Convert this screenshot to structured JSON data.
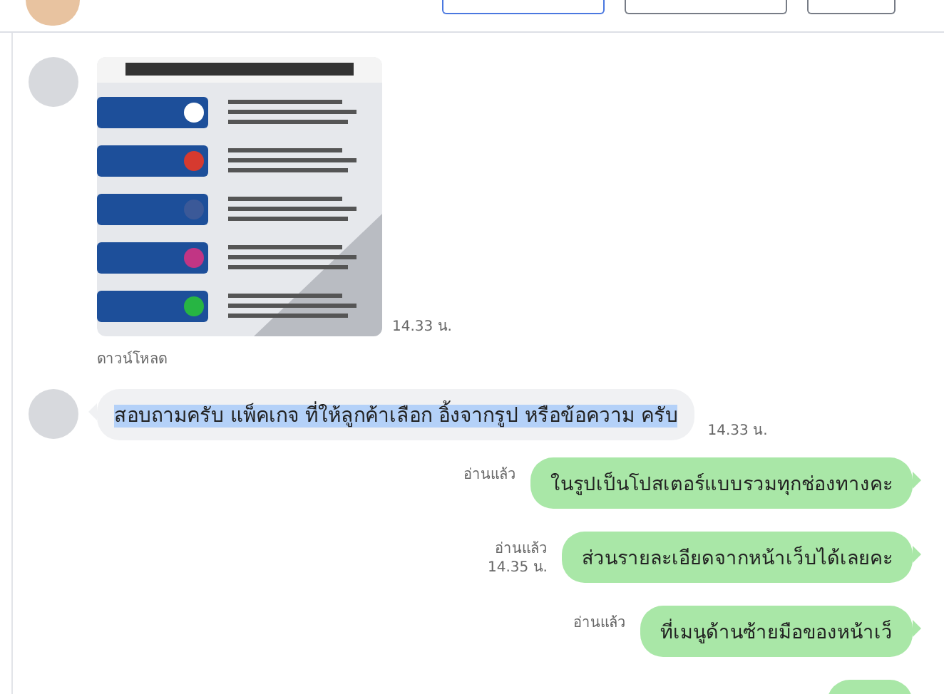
{
  "messages": [
    {
      "kind": "image",
      "time": "14.33 น.",
      "download": "ดาวน์โหลด"
    },
    {
      "kind": "incoming",
      "text": "สอบถามครับ แพ็คเกจ ที่ให้ลูกค้าเลือก อิ้งจากรูป หรือข้อความ ครับ",
      "highlighted": true,
      "time": "14.33 น."
    },
    {
      "kind": "outgoing",
      "status": "อ่านแล้ว",
      "text": "ในรูปเป็นโปสเตอร์แบบรวมทุกช่องทางคะ"
    },
    {
      "kind": "outgoing",
      "status": "อ่านแล้ว",
      "time": "14.35 น.",
      "text": "ส่วนรายละเอียดจากหน้าเว็บได้เลยคะ"
    },
    {
      "kind": "outgoing",
      "status": "อ่านแล้ว",
      "text": "ที่เมนูด้านซ้ายมือของหน้าเว็"
    },
    {
      "kind": "partial"
    }
  ]
}
